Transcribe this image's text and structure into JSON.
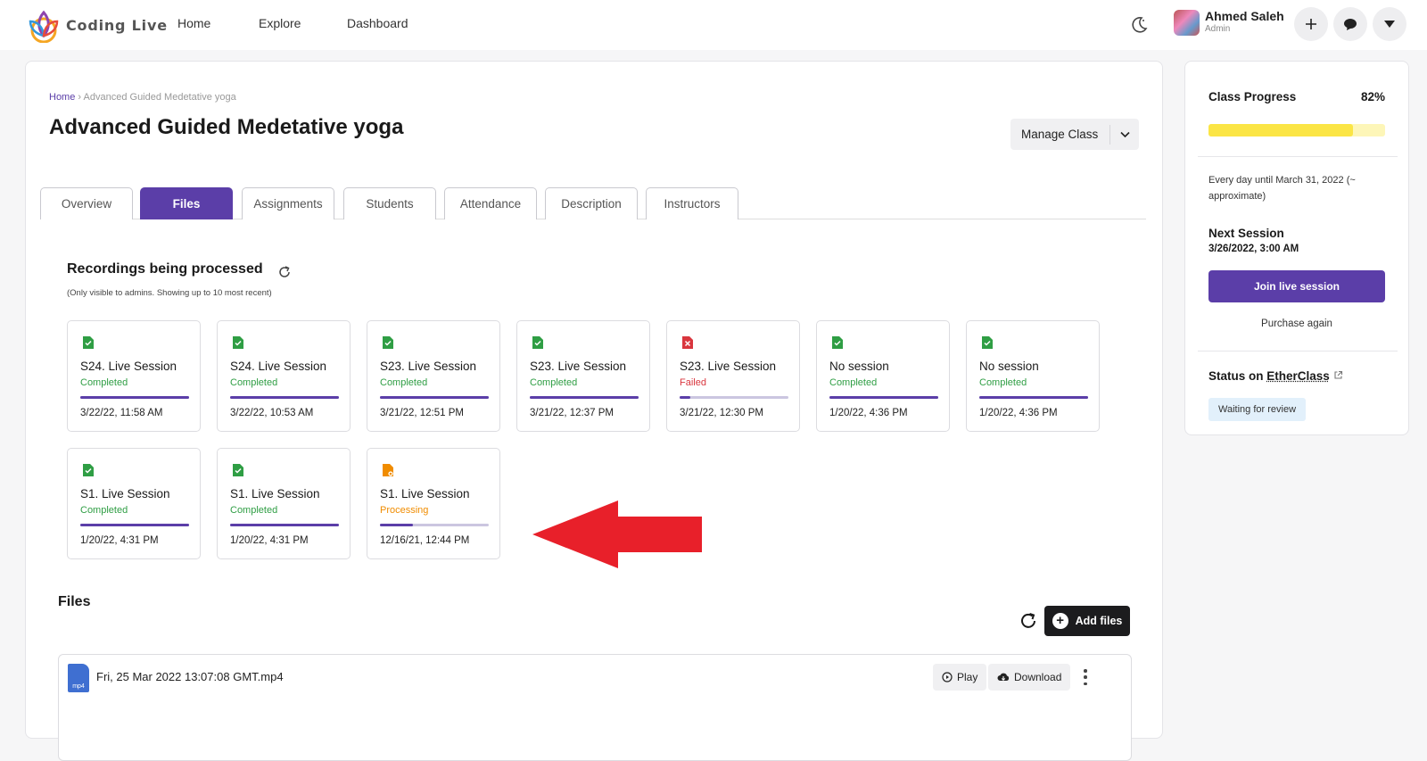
{
  "app": {
    "logo_text": "Coding Live"
  },
  "nav": {
    "items": [
      "Home",
      "Explore",
      "Dashboard"
    ]
  },
  "user": {
    "name": "Ahmed Saleh",
    "role": "Admin"
  },
  "breadcrumb": {
    "home": "Home",
    "separator": "›",
    "current": "Advanced Guided Medetative yoga"
  },
  "page": {
    "title": "Advanced Guided Medetative yoga",
    "manage_label": "Manage Class"
  },
  "tabs": [
    "Overview",
    "Files",
    "Assignments",
    "Students",
    "Attendance",
    "Description",
    "Instructors"
  ],
  "active_tab": "Files",
  "recordings": {
    "title": "Recordings being processed",
    "subtitle": "(Only visible to admins. Showing up to 10 most recent)",
    "items": [
      {
        "name": "S24. Live Session",
        "status": "Completed",
        "date": "3/22/22, 11:58 AM",
        "progress": 100
      },
      {
        "name": "S24. Live Session",
        "status": "Completed",
        "date": "3/22/22, 10:53 AM",
        "progress": 100
      },
      {
        "name": "S23. Live Session",
        "status": "Completed",
        "date": "3/21/22, 12:51 PM",
        "progress": 100
      },
      {
        "name": "S23. Live Session",
        "status": "Completed",
        "date": "3/21/22, 12:37 PM",
        "progress": 100
      },
      {
        "name": "S23. Live Session",
        "status": "Failed",
        "date": "3/21/22, 12:30 PM",
        "progress": 10
      },
      {
        "name": "No session",
        "status": "Completed",
        "date": "1/20/22, 4:36 PM",
        "progress": 100
      },
      {
        "name": "No session",
        "status": "Completed",
        "date": "1/20/22, 4:36 PM",
        "progress": 100
      },
      {
        "name": "S1. Live Session",
        "status": "Completed",
        "date": "1/20/22, 4:31 PM",
        "progress": 100
      },
      {
        "name": "S1. Live Session",
        "status": "Completed",
        "date": "1/20/22, 4:31 PM",
        "progress": 100
      },
      {
        "name": "S1. Live Session",
        "status": "Processing",
        "date": "12/16/21, 12:44 PM",
        "progress": 30
      }
    ]
  },
  "files": {
    "title": "Files",
    "add_label": "Add files",
    "items": [
      {
        "type": "mp4",
        "name": "Fri, 25 Mar 2022 13:07:08 GMT.mp4",
        "play_label": "Play",
        "download_label": "Download"
      }
    ]
  },
  "sidebar": {
    "progress_label": "Class Progress",
    "progress_text": "82%",
    "progress_value": 82,
    "schedule": "Every day until March 31, 2022 (~ approximate)",
    "next_session_label": "Next Session",
    "next_session_date": "3/26/2022, 3:00 AM",
    "join_label": "Join live session",
    "purchase_label": "Purchase again",
    "status_label": "Status on",
    "status_platform": "EtherClass",
    "status_badge": "Waiting for review"
  },
  "colors": {
    "primary": "#5b3ea8",
    "completed": "#2f9e44",
    "failed": "#d9363e",
    "processing": "#f08c00",
    "progress_bar": "#fbe545",
    "annotation_arrow": "#e8202a"
  }
}
